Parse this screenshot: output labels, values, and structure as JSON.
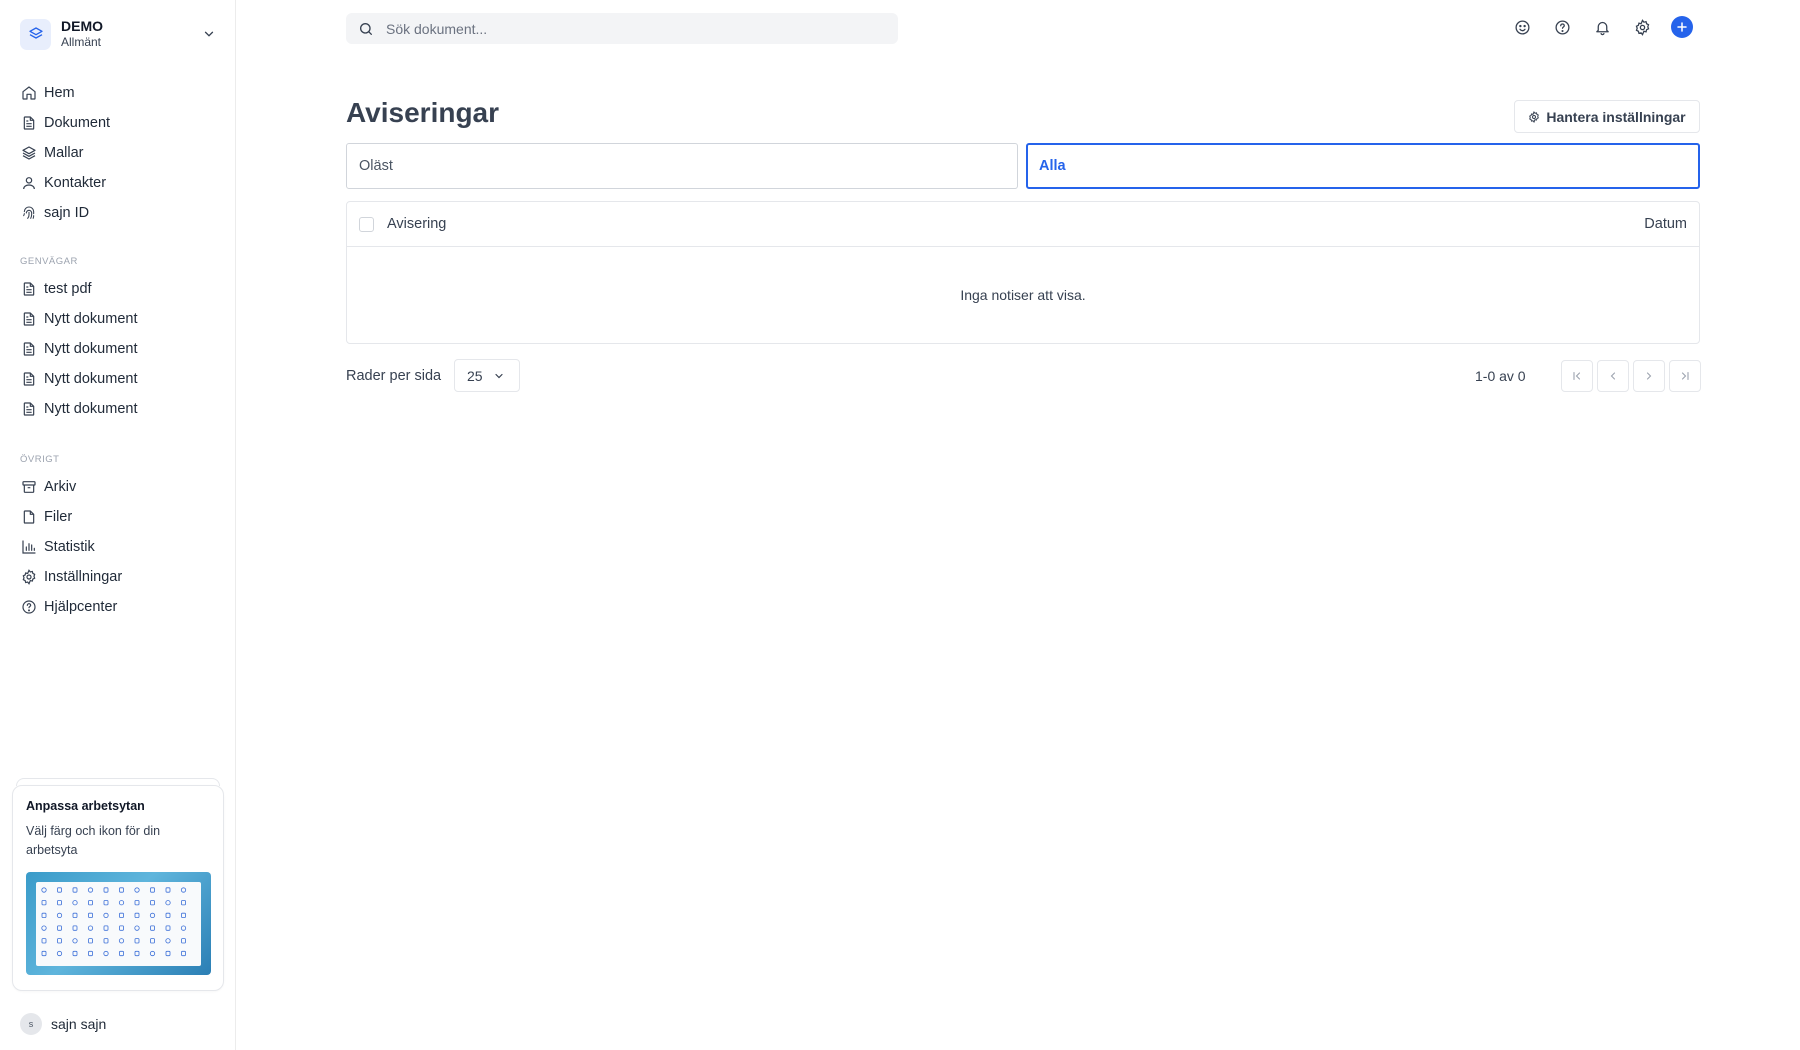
{
  "workspace": {
    "name": "DEMO",
    "subtitle": "Allmänt"
  },
  "sidebar": {
    "main_items": [
      {
        "label": "Hem",
        "icon": "home-icon"
      },
      {
        "label": "Dokument",
        "icon": "document-icon"
      },
      {
        "label": "Mallar",
        "icon": "layers-icon"
      },
      {
        "label": "Kontakter",
        "icon": "user-icon"
      },
      {
        "label": "sajn ID",
        "icon": "fingerprint-icon"
      }
    ],
    "shortcuts_label": "GENVÄGAR",
    "shortcuts": [
      {
        "label": "test pdf",
        "icon": "document-icon"
      },
      {
        "label": "Nytt dokument",
        "icon": "document-icon"
      },
      {
        "label": "Nytt dokument",
        "icon": "document-icon"
      },
      {
        "label": "Nytt dokument",
        "icon": "document-icon"
      },
      {
        "label": "Nytt dokument",
        "icon": "document-icon"
      }
    ],
    "other_label": "ÖVRIGT",
    "other": [
      {
        "label": "Arkiv",
        "icon": "archive-icon"
      },
      {
        "label": "Filer",
        "icon": "file-icon"
      },
      {
        "label": "Statistik",
        "icon": "bar-chart-icon"
      },
      {
        "label": "Inställningar",
        "icon": "gear-icon"
      },
      {
        "label": "Hjälpcenter",
        "icon": "help-circle-icon"
      }
    ],
    "promo": {
      "title": "Anpassa arbetsytan",
      "text": "Välj färg och ikon för din arbetsyta"
    },
    "user": {
      "initial": "s",
      "name": "sajn sajn"
    }
  },
  "search": {
    "placeholder": "Sök dokument..."
  },
  "page": {
    "title": "Aviseringar",
    "manage_button": "Hantera inställningar",
    "tabs": [
      {
        "label": "Oläst",
        "active": false
      },
      {
        "label": "Alla",
        "active": true
      }
    ],
    "table": {
      "col_notice": "Avisering",
      "col_date": "Datum",
      "empty_text": "Inga notiser att visa."
    },
    "pagination": {
      "rows_label": "Rader per sida",
      "rows_value": "25",
      "range_text": "1-0 av 0"
    }
  },
  "colors": {
    "accent": "#2563eb",
    "border": "#e5e7eb",
    "text": "#374151"
  }
}
